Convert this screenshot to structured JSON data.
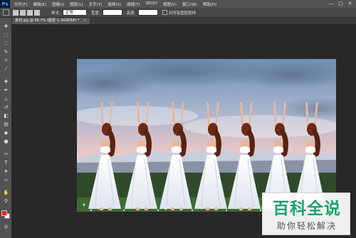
{
  "app": {
    "logo": "Ps"
  },
  "menu": [
    "文件(F)",
    "编辑(E)",
    "图像(I)",
    "图层(L)",
    "文字(Y)",
    "选择(S)",
    "滤镜(T)",
    "3D(D)",
    "视图(V)",
    "窗口(W)",
    "帮助(H)"
  ],
  "window_controls": {
    "minimize": "—",
    "maximize": "□",
    "close": "✕"
  },
  "options_bar": {
    "style_label": "样式:",
    "style_value": "正常",
    "width_label": "宽度:",
    "width_value": "",
    "height_label": "高度:",
    "height_value": "",
    "check_label": "对所有图层取样"
  },
  "document_tab": {
    "title": "素材.jpg @ 66.7% (图层 1, RGB/8#) *",
    "close": "×"
  },
  "tools": [
    "move-icon",
    "marquee-icon",
    "lasso-icon",
    "quick-select-icon",
    "crop-icon",
    "eyedropper-icon",
    "healing-icon",
    "brush-icon",
    "stamp-icon",
    "history-brush-icon",
    "eraser-icon",
    "gradient-icon",
    "blur-icon",
    "dodge-icon",
    "pen-icon",
    "type-icon",
    "path-select-icon",
    "shape-icon",
    "hand-icon",
    "zoom-icon"
  ],
  "colors": {
    "foreground": "#e1261c",
    "background": "#ffffff",
    "accent_green": "#1aa36a"
  },
  "watermark": {
    "title": "百科全说",
    "subtitle": "助你轻松解决"
  }
}
